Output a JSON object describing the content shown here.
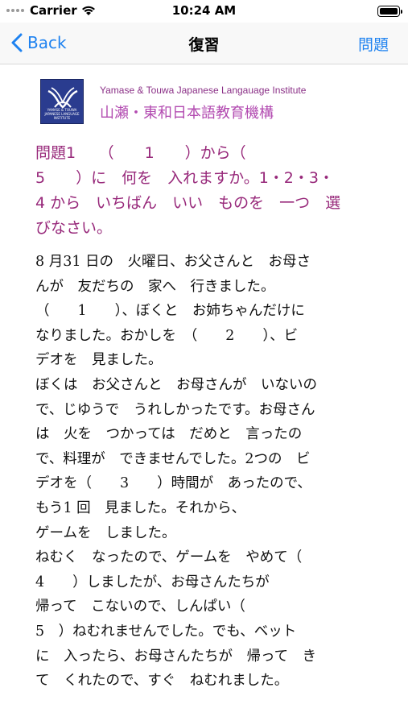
{
  "status": {
    "carrier": "Carrier",
    "time": "10:24 AM"
  },
  "nav": {
    "back_label": "Back",
    "title": "復習",
    "right_label": "問題"
  },
  "institute": {
    "name_en": "Yamase & Touwa Japanese Langauage Institute",
    "name_jp": "山瀬・東和日本語教育機構",
    "logo_text": "YAMASE & TOUWA JAPANESE LANGUAGE INSTITUTE"
  },
  "question": {
    "lines": [
      "問題1　　（　　1　　）から（",
      "5　　）に　何を　入れますか。1・2・3・",
      "4 から　いちばん　いい　ものを　一つ　選",
      "びなさい。"
    ]
  },
  "passage": {
    "lines": [
      "8 月31 日の　火曜日、お父さんと　お母さ",
      "んが　友だちの　家へ　行きました。",
      "（　　1　　）、ぼくと　お姉ちゃんだけに",
      "なりました。おかしを　（　　2　　）、ビ",
      "デオを　見ました。",
      "ぼくは　お父さんと　お母さんが　いないの",
      "で、じゆうで　うれしかったです。お母さん",
      "は　火を　つかっては　だめと　言ったの",
      "で、料理が　できませんでした。2つの　ビ",
      "デオを（　　3　　）時間が　あったので、",
      "もう1 回　見ました。それから、",
      "ゲームを　しました。",
      "ねむく　なったので、ゲームを　やめて（",
      "4　　）しましたが、お母さんたちが",
      "帰って　こないので、しんぱい（",
      "5　）ねむれませんでした。でも、ベット",
      "に　入ったら、お母さんたちが　帰って　き",
      "て　くれたので、すぐ　ねむれました。"
    ]
  },
  "colors": {
    "accent": "#1e82f0",
    "question": "#97287a",
    "institute": "#b24ab0"
  }
}
